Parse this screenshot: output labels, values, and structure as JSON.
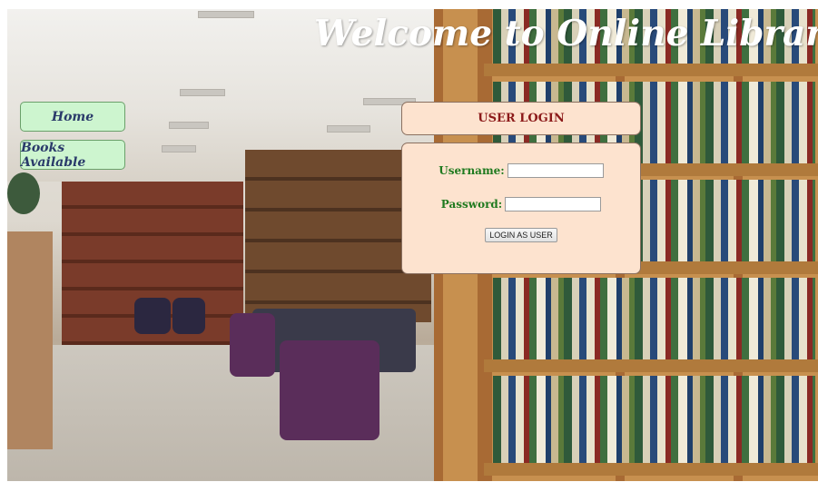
{
  "page": {
    "title": "Welcome to Online Library"
  },
  "nav": {
    "items": [
      {
        "label": "Home"
      },
      {
        "label": "Books Available"
      }
    ]
  },
  "login": {
    "header": "USER LOGIN",
    "username_label": "Username:",
    "username_value": "",
    "password_label": "Password:",
    "password_value": "",
    "submit_label": "LOGIN AS USER"
  },
  "colors": {
    "nav_button_bg": "#cdf5cf",
    "login_panel_bg": "#fde3cf",
    "login_header_text": "#8c1a1a",
    "label_text": "#1f7a1f",
    "title_text": "#ffffff"
  },
  "background": {
    "image": "library-interior-photo"
  }
}
